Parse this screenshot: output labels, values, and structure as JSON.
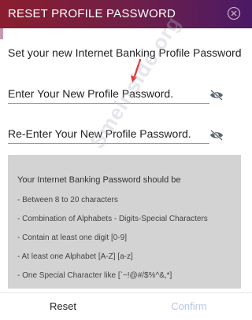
{
  "dialog": {
    "title": "RESET PROFILE PASSWORD",
    "close_icon": "close-circle-icon"
  },
  "instruction": "Set your new Internet Banking Profile Password",
  "fields": {
    "new_password_placeholder": "Enter Your New Profile Password.",
    "reenter_password_placeholder": "Re-Enter Your New Profile Password.",
    "toggle_icon": "eye-slash-icon"
  },
  "rules": {
    "heading": "Your Internet Banking Password should be",
    "items": [
      "- Between 8 to 20 characters",
      "- Combination of Alphabets - Digits-Special Characters",
      "- Contain at least one digit [0-9]",
      "- At least one Alphabet [A-Z] [a-z]",
      "- One Special Character like [`~!@#/$%^&,*]"
    ]
  },
  "watermark": "Smeinside.org",
  "footer": {
    "reset_label": "Reset",
    "confirm_label": "Confirm"
  },
  "colors": {
    "header_start": "#8a1e2f",
    "header_end": "#4a1a66",
    "arrow": "#e53935",
    "confirm_disabled": "#b8c6e8",
    "rules_background": "#d3d3d3"
  }
}
